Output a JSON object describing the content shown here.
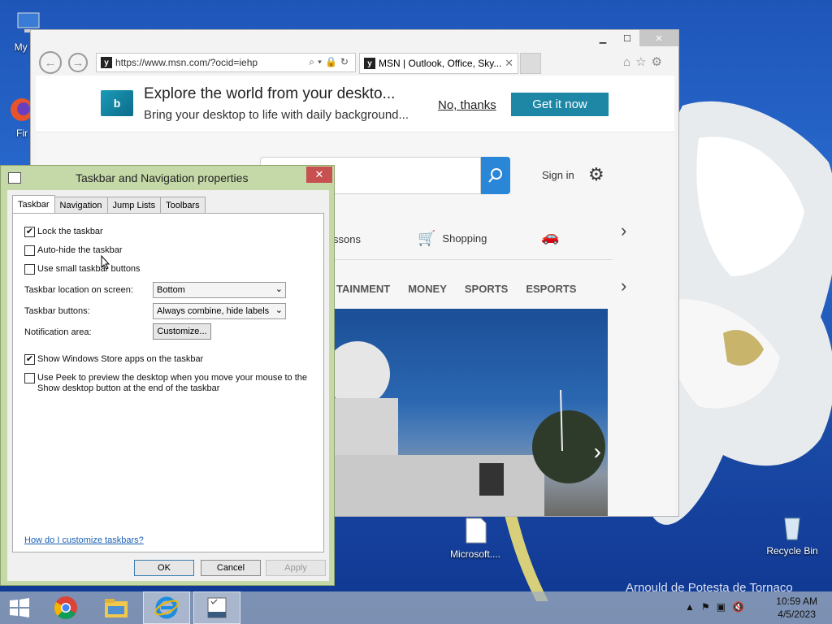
{
  "desktop": {
    "icons": [
      {
        "label": "My Co"
      },
      {
        "label": "Fir"
      },
      {
        "label": "Microsoft...."
      },
      {
        "label": "Recycle Bin"
      }
    ],
    "watermark": "Arnould de Potesta de Tornaco"
  },
  "ie": {
    "url": "https://www.msn.com/?ocid=iehp",
    "tab_title": "MSN | Outlook, Office, Sky...",
    "promo": {
      "title": "Explore the world from your deskto...",
      "subtitle": "Bring your desktop to life with daily background...",
      "no_thanks": "No, thanks",
      "get_it": "Get it now"
    },
    "signin": "Sign in",
    "quicklinks": {
      "partial": "ssons",
      "shopping": "Shopping",
      "partial2": "C"
    },
    "categories": [
      "TAINMENT",
      "MONEY",
      "SPORTS",
      "ESPORTS"
    ]
  },
  "dialog": {
    "title": "Taskbar and Navigation properties",
    "tabs": [
      "Taskbar",
      "Navigation",
      "Jump Lists",
      "Toolbars"
    ],
    "options": {
      "lock": {
        "label": "Lock the taskbar",
        "checked": true
      },
      "autohide": {
        "label": "Auto-hide the taskbar",
        "checked": false
      },
      "small": {
        "label": "Use small taskbar buttons",
        "checked": false
      },
      "store": {
        "label": "Show Windows Store apps on the taskbar",
        "checked": true
      },
      "peek": {
        "label": "Use Peek to preview the desktop when you move your mouse to the Show desktop button at the end of the taskbar",
        "checked": false
      }
    },
    "location_label": "Taskbar location on screen:",
    "location_value": "Bottom",
    "buttons_label": "Taskbar buttons:",
    "buttons_value": "Always combine, hide labels",
    "notif_label": "Notification area:",
    "customize": "Customize...",
    "help_link": "How do I customize taskbars?",
    "ok": "OK",
    "cancel": "Cancel",
    "apply": "Apply"
  },
  "taskbar": {
    "time": "10:59 AM",
    "date": "4/5/2023"
  }
}
